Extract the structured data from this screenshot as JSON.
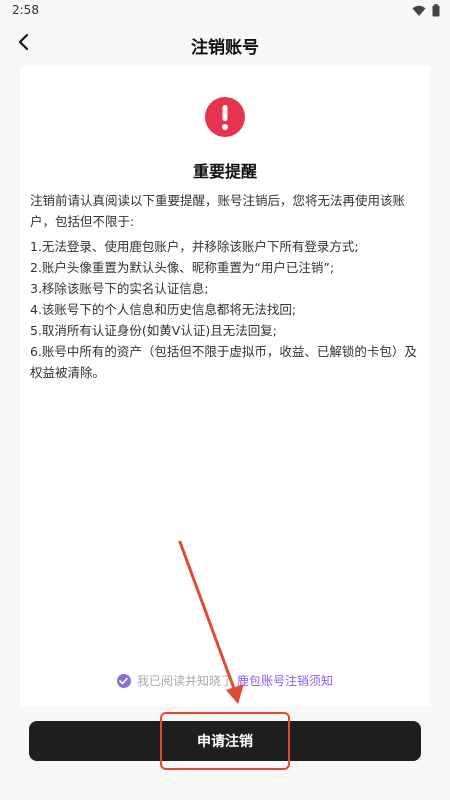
{
  "status_bar": {
    "time": "2:58",
    "icons": [
      "wifi-icon",
      "battery-icon"
    ]
  },
  "header": {
    "title": "注销账号",
    "back_icon": "back-arrow-icon"
  },
  "notice": {
    "icon": "warning-icon",
    "icon_color": "#e8334f",
    "title": "重要提醒",
    "intro": "注销前请认真阅读以下重要提醒，账号注销后，您将无法再使用该账户，包括但不限于:",
    "items": [
      "1.无法登录、使用鹿包账户，并移除该账户下所有登录方式;",
      "2.账户头像重置为默认头像、昵称重置为“用户已注销”;",
      "3.移除该账号下的实名认证信息;",
      "4.该账号下的个人信息和历史信息都将无法找回;",
      "5.取消所有认证身份(如黄V认证)且无法回复;",
      "6.账号中所有的资产（包括但不限于虚拟币，收益、已解锁的卡包）及权益被清除。"
    ]
  },
  "agreement": {
    "checked": true,
    "text": "我已阅读并知晓了",
    "link_text": "鹿包账号注销须知",
    "accent_color": "#8b5cf6"
  },
  "action": {
    "apply_label": "申请注销"
  },
  "colors": {
    "button_bg": "#1f1f1f",
    "annotation": "#e04b33"
  }
}
